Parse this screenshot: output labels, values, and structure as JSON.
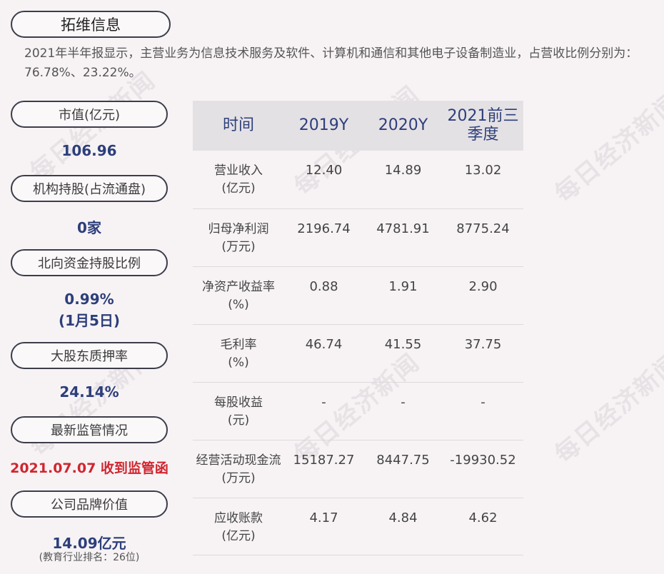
{
  "company": "拓维信息",
  "summary": "2021年半年报显示，主营业务为信息技术服务及软件、计算机和通信和其他电子设备制造业，占营收比例分别为：76.78%、23.22%。",
  "left": {
    "market_cap_label": "市值(亿元)",
    "market_cap_value": "106.96",
    "inst_label": "机构持股(占流通盘)",
    "inst_value": "0家",
    "north_label": "北向资金持股比例",
    "north_value": "0.99%",
    "north_date": "(1月5日)",
    "pledge_label": "大股东质押率",
    "pledge_value": "24.14%",
    "reg_label": "最新监管情况",
    "reg_value": "2021.07.07 收到监管函",
    "brand_label": "公司品牌价值",
    "brand_value": "14.09亿元",
    "brand_rank": "(教育行业排名：26位)"
  },
  "table": {
    "headers": [
      "时间",
      "2019Y",
      "2020Y",
      "2021前三季度"
    ],
    "rows": [
      {
        "label": "营业收入",
        "unit": "(亿元)",
        "values": [
          "12.40",
          "14.89",
          "13.02"
        ]
      },
      {
        "label": "归母净利润",
        "unit": "(万元)",
        "values": [
          "2196.74",
          "4781.91",
          "8775.24"
        ]
      },
      {
        "label": "净资产收益率",
        "unit": "(%)",
        "values": [
          "0.88",
          "1.91",
          "2.90"
        ]
      },
      {
        "label": "毛利率",
        "unit": "(%)",
        "values": [
          "46.74",
          "41.55",
          "37.75"
        ]
      },
      {
        "label": "每股收益",
        "unit": "(元)",
        "values": [
          "-",
          "-",
          "-"
        ]
      },
      {
        "label": "经营活动现金流",
        "unit": "(万元)",
        "values": [
          "15187.27",
          "8447.75",
          "-19930.52"
        ]
      },
      {
        "label": "应收账款",
        "unit": "(亿元)",
        "values": [
          "4.17",
          "4.84",
          "4.62"
        ]
      }
    ]
  },
  "watermark": "每日经济新闻"
}
